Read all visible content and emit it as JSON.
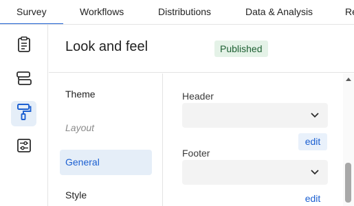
{
  "topnav": {
    "tabs": [
      {
        "label": "Survey",
        "active": true
      },
      {
        "label": "Workflows",
        "active": false
      },
      {
        "label": "Distributions",
        "active": false
      },
      {
        "label": "Data & Analysis",
        "active": false
      },
      {
        "label": "Re",
        "active": false
      }
    ]
  },
  "rail": {
    "items": [
      {
        "icon": "clipboard-icon",
        "active": false
      },
      {
        "icon": "blocks-icon",
        "active": false
      },
      {
        "icon": "paint-roller-icon",
        "active": true
      },
      {
        "icon": "sliders-icon",
        "active": false
      }
    ]
  },
  "header": {
    "title": "Look and feel",
    "status": "Published"
  },
  "subnav": {
    "items": [
      {
        "label": "Theme",
        "state": "normal"
      },
      {
        "label": "Layout",
        "state": "muted"
      },
      {
        "label": "General",
        "state": "active"
      },
      {
        "label": "Style",
        "state": "normal"
      }
    ]
  },
  "panel": {
    "header_label": "Header",
    "header_value": "",
    "header_edit": "edit",
    "footer_label": "Footer",
    "footer_value": "",
    "footer_edit": "edit"
  },
  "colors": {
    "accent": "#1b5fd1",
    "active_bg": "#e5eef8",
    "badge_bg": "#e4f2e7",
    "badge_text": "#1d5f32"
  }
}
